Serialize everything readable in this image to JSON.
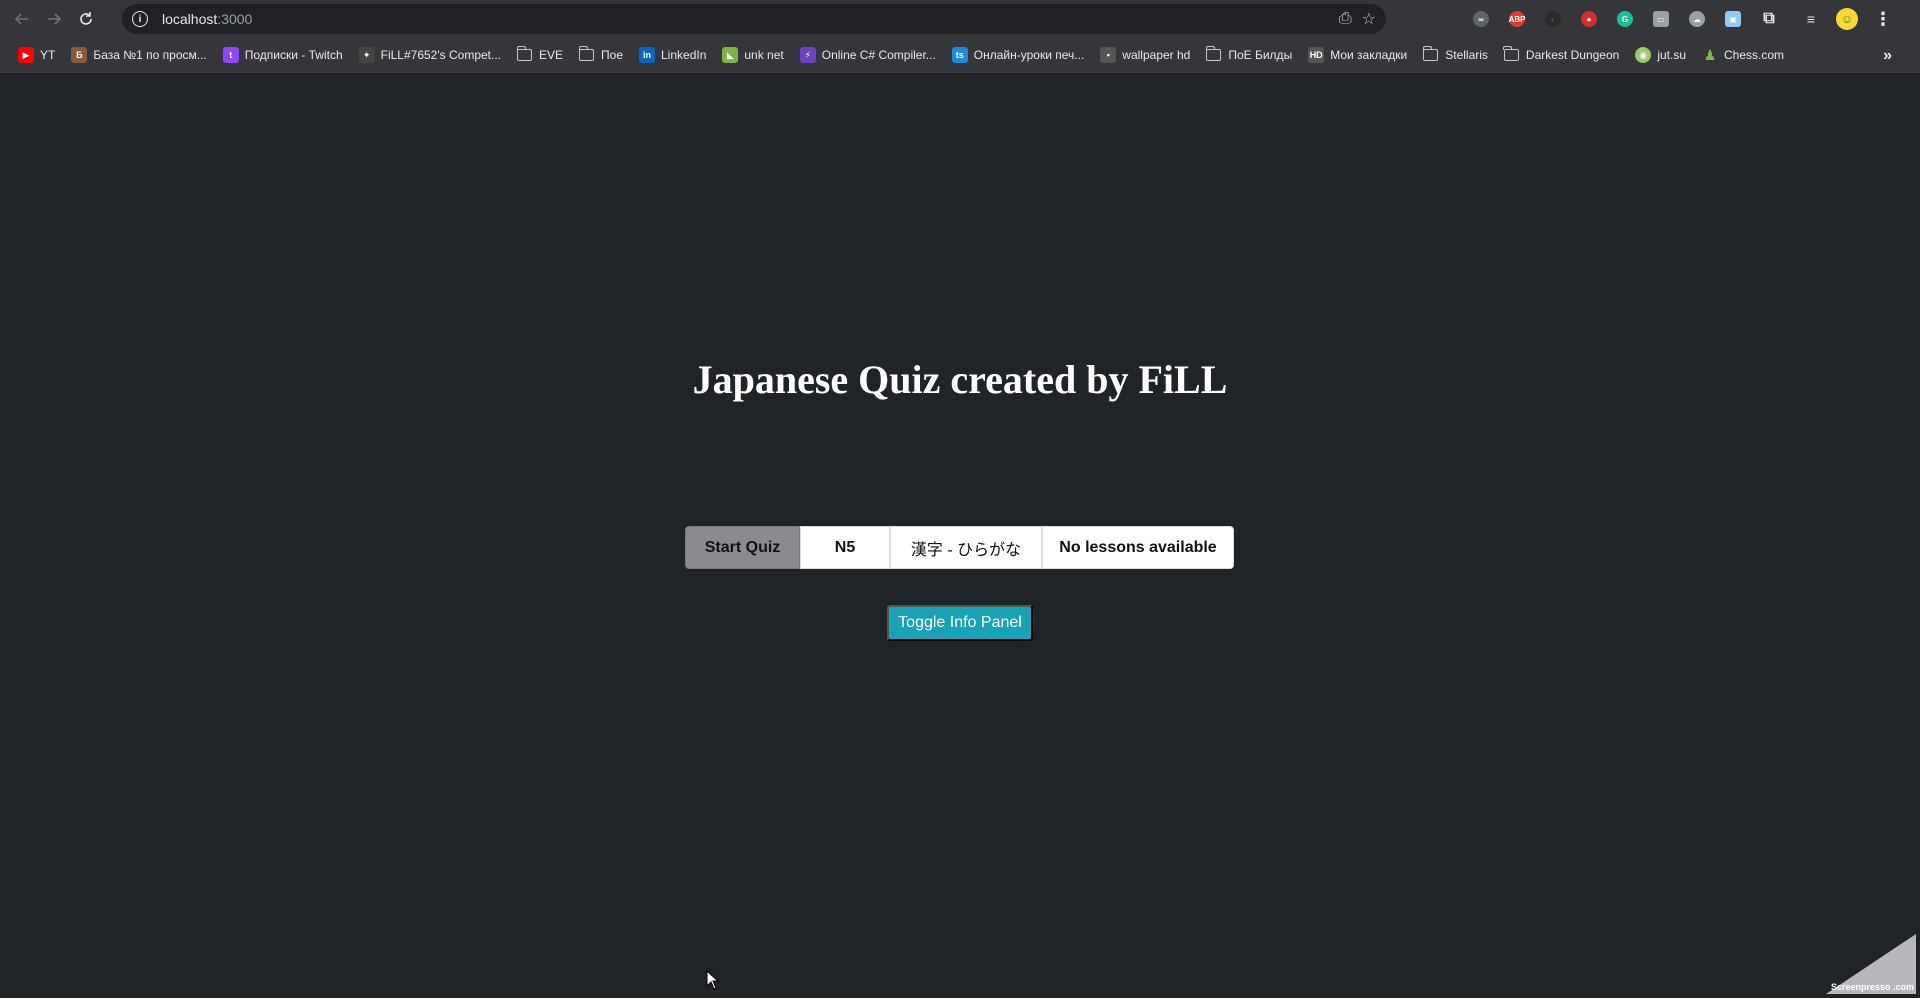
{
  "browser": {
    "url_host": "localhost",
    "url_port": ":3000"
  },
  "bookmarks": [
    {
      "label": "YT",
      "icon": "youtube-icon",
      "color": "#ff0000"
    },
    {
      "label": "База №1 по просм...",
      "icon": "site-icon",
      "color": "#8a5a3c"
    },
    {
      "label": "Подписки - Twitch",
      "icon": "twitch-icon",
      "color": "#9146ff"
    },
    {
      "label": "FiLL#7652's Compet...",
      "icon": "site-icon",
      "color": "#444444"
    },
    {
      "label": "EVE",
      "icon": "folder-icon"
    },
    {
      "label": "Пое",
      "icon": "folder-icon"
    },
    {
      "label": "LinkedIn",
      "icon": "linkedin-icon",
      "color": "#0a66c2"
    },
    {
      "label": "unk net",
      "icon": "site-icon",
      "color": "#7cb342"
    },
    {
      "label": "Online C# Compiler...",
      "icon": "bolt-icon",
      "color": "#6f42c1"
    },
    {
      "label": "Онлайн-уроки печ...",
      "icon": "site-icon",
      "color": "#1e88e5"
    },
    {
      "label": "wallpaper hd",
      "icon": "site-icon",
      "color": "#555555"
    },
    {
      "label": "ПоЕ Билды",
      "icon": "folder-icon"
    },
    {
      "label": "Мои закладки",
      "icon": "site-icon",
      "color": "#555555"
    },
    {
      "label": "Stellaris",
      "icon": "folder-icon"
    },
    {
      "label": "Darkest Dungeon",
      "icon": "folder-icon"
    },
    {
      "label": "jut.su",
      "icon": "site-icon",
      "color": "#9ccc65"
    },
    {
      "label": "Chess.com",
      "icon": "chess-icon",
      "color": "#81b64c"
    }
  ],
  "app": {
    "title": "Japanese Quiz created by FiLL",
    "start_label": "Start Quiz",
    "level_value": "N5",
    "script_value": "漢字 - ひらがな",
    "lesson_value": "No lessons available",
    "toggle_label": "Toggle Info Panel"
  },
  "watermark": "Screenpresso .com",
  "colors": {
    "page_bg": "#202328",
    "toggle_bg": "#17a2b8",
    "start_bg": "#8b8a8e"
  }
}
